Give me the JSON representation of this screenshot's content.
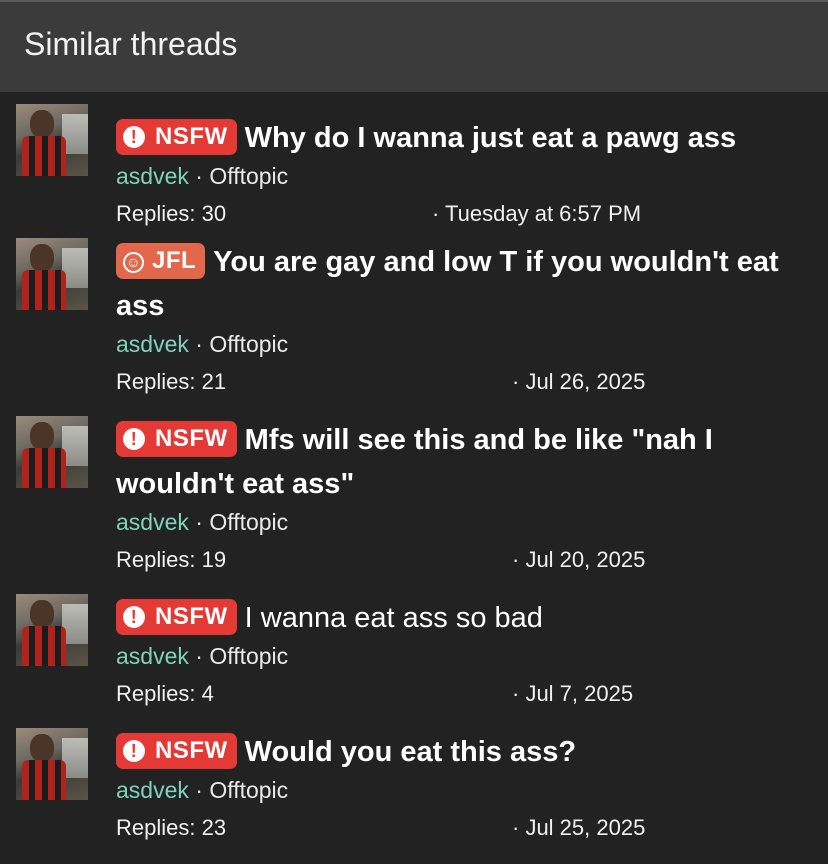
{
  "header": {
    "title": "Similar threads"
  },
  "threads": [
    {
      "badge": "NSFW",
      "badge_type": "nsfw",
      "badge_icon": "exclamation-circle-icon",
      "title": "Why do I wanna just eat a pawg ass",
      "title_bold": true,
      "author": "asdvek",
      "forum": "Offtopic",
      "replies": "Replies: 30",
      "date": "· Tuesday at 6:57 PM"
    },
    {
      "badge": "JFL",
      "badge_type": "jfl",
      "badge_icon": "laughing-face-icon",
      "title": "You are gay and low T if you wouldn't eat ass",
      "title_bold": true,
      "author": "asdvek",
      "forum": "Offtopic",
      "replies": "Replies: 21",
      "date": "· Jul 26, 2025"
    },
    {
      "badge": "NSFW",
      "badge_type": "nsfw",
      "badge_icon": "exclamation-circle-icon",
      "title": "Mfs will see this and be like \"nah I wouldn't eat ass\"",
      "title_bold": true,
      "author": "asdvek",
      "forum": "Offtopic",
      "replies": "Replies: 19",
      "date": "· Jul 20, 2025"
    },
    {
      "badge": "NSFW",
      "badge_type": "nsfw",
      "badge_icon": "exclamation-circle-icon",
      "title": "I wanna eat ass so bad",
      "title_bold": false,
      "author": "asdvek",
      "forum": "Offtopic",
      "replies": "Replies: 4",
      "date": "· Jul 7, 2025"
    },
    {
      "badge": "NSFW",
      "badge_type": "nsfw",
      "badge_icon": "exclamation-circle-icon",
      "title": "Would you eat this ass?",
      "title_bold": true,
      "author": "asdvek",
      "forum": "Offtopic",
      "replies": "Replies: 23",
      "date": "· Jul 25, 2025"
    }
  ],
  "separator": " · ",
  "colors": {
    "background": "#222222",
    "header": "#3b3b3b",
    "nsfw": "#e53935",
    "jfl": "#e2674b",
    "author": "#7fd3b9"
  }
}
